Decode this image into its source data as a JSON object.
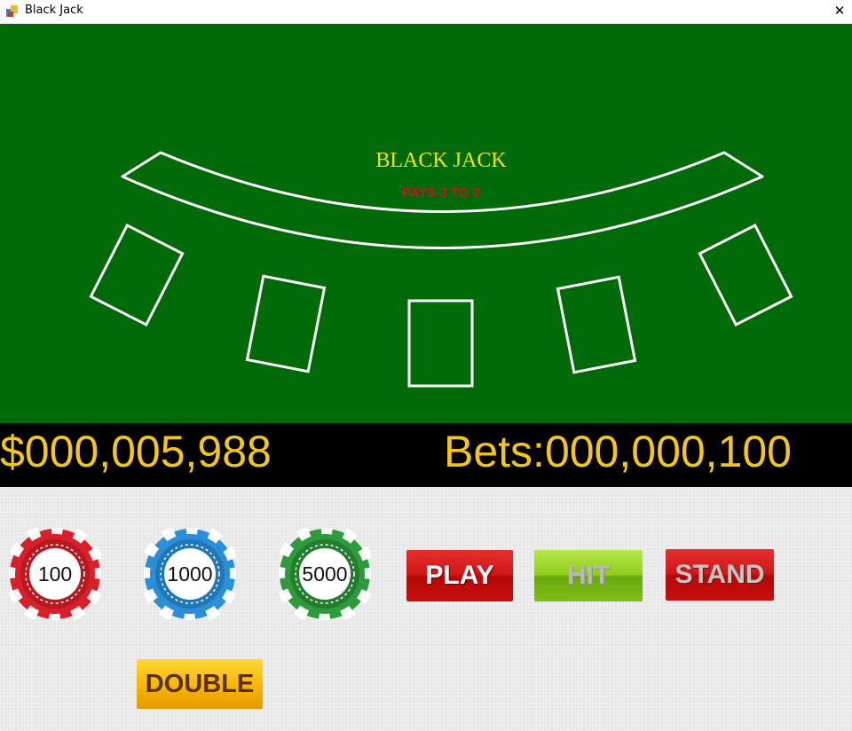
{
  "window": {
    "title": "Black Jack",
    "close_glyph": "✕"
  },
  "table": {
    "felt_color": "#016a08",
    "line_color": "#ffffff",
    "title": "BLACK JACK",
    "title_color": "#f2e600",
    "subtitle": "PAYS 3 TO 2",
    "subtitle_color": "#c8102e"
  },
  "status": {
    "money": "$000,005,988",
    "bets": "Bets:000,000,100",
    "text_color": "#f5c518"
  },
  "chips": [
    {
      "label": "100",
      "color": "#d8202a"
    },
    {
      "label": "1000",
      "color": "#2a8fd6"
    },
    {
      "label": "5000",
      "color": "#2f9a3c"
    }
  ],
  "buttons": {
    "play": "PLAY",
    "hit": "HIT",
    "stand": "STAND",
    "double": "DOUBLE"
  }
}
